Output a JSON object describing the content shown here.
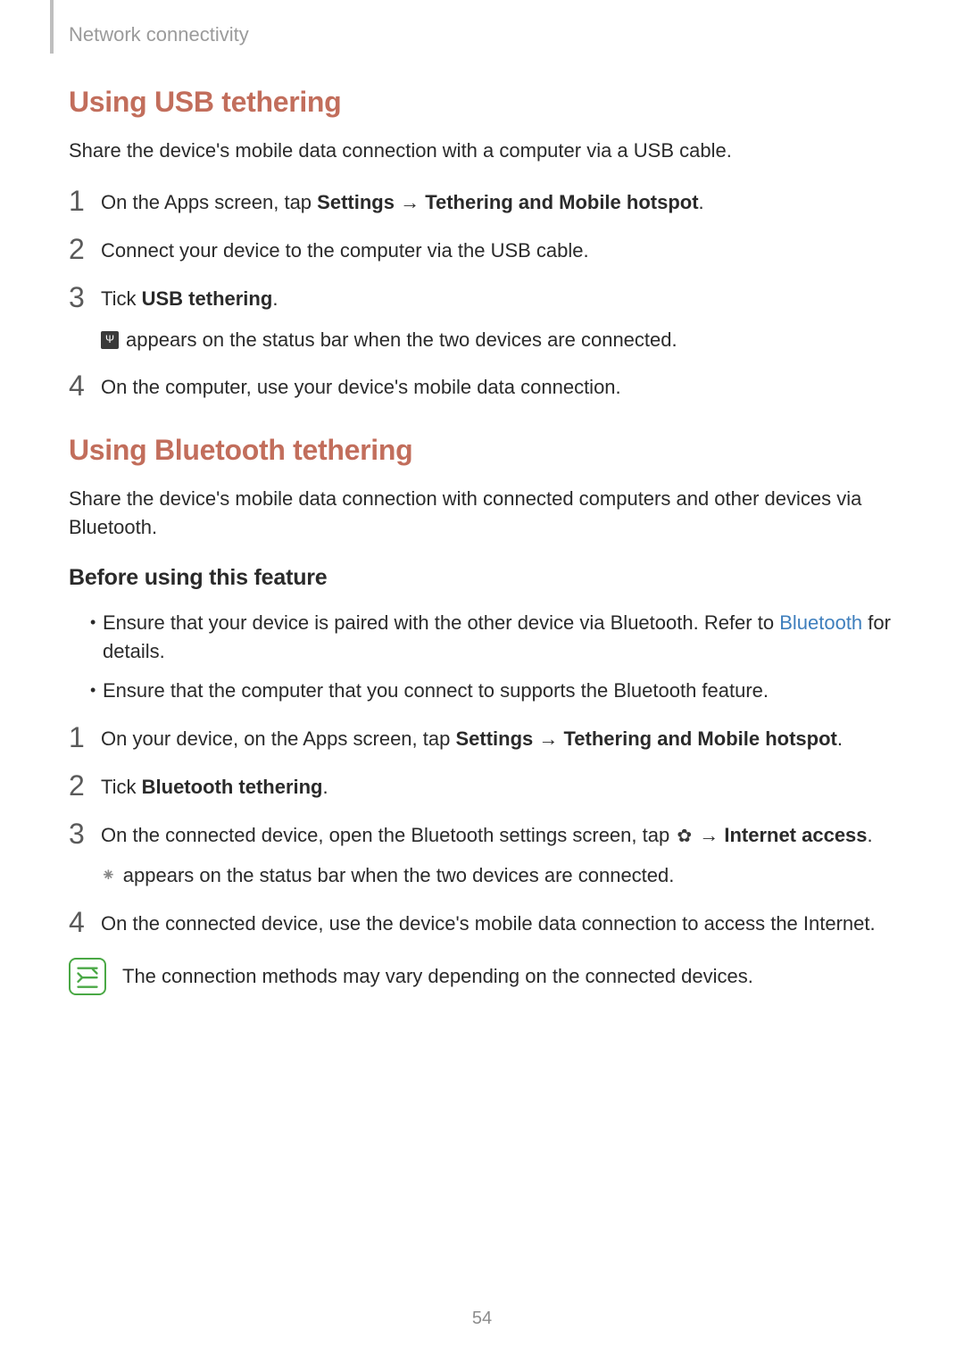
{
  "breadcrumb": "Network connectivity",
  "section1": {
    "heading": "Using USB tethering",
    "intro": "Share the device's mobile data connection with a computer via a USB cable.",
    "steps": {
      "s1": {
        "pre": "On the Apps screen, tap ",
        "bold1": "Settings",
        "arrow": " → ",
        "bold2": "Tethering and Mobile hotspot",
        "post": "."
      },
      "s2": "Connect your device to the computer via the USB cable.",
      "s3": {
        "pre": "Tick ",
        "bold": "USB tethering",
        "post": ".",
        "sub_icon": "Ψ",
        "sub": " appears on the status bar when the two devices are connected."
      },
      "s4": "On the computer, use your device's mobile data connection."
    }
  },
  "section2": {
    "heading": "Using Bluetooth tethering",
    "intro": "Share the device's mobile data connection with connected computers and other devices via Bluetooth.",
    "sub_heading": "Before using this feature",
    "bullets": {
      "b1": {
        "pre": "Ensure that your device is paired with the other device via Bluetooth. Refer to ",
        "link": "Bluetooth",
        "post": " for details."
      },
      "b2": "Ensure that the computer that you connect to supports the Bluetooth feature."
    },
    "steps": {
      "s1": {
        "pre": "On your device, on the Apps screen, tap ",
        "bold1": "Settings",
        "arrow": " → ",
        "bold2": "Tethering and Mobile hotspot",
        "post": "."
      },
      "s2": {
        "pre": "Tick ",
        "bold": "Bluetooth tethering",
        "post": "."
      },
      "s3": {
        "pre": "On the connected device, open the Bluetooth settings screen, tap ",
        "arrow": " → ",
        "bold": "Internet access",
        "post": ".",
        "sub": " appears on the status bar when the two devices are connected."
      },
      "s4": "On the connected device, use the device's mobile data connection to access the Internet."
    },
    "note": "The connection methods may vary depending on the connected devices."
  },
  "page_number": "54"
}
